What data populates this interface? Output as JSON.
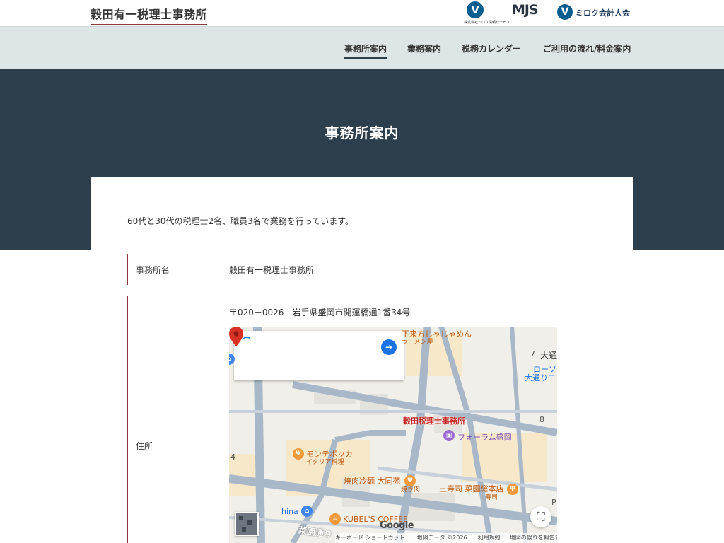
{
  "header": {
    "site_title": "穀田有一税理士事務所",
    "logos": {
      "mirokujoho_caption": "株式会社ミロク情報サービス",
      "mjs": "MJS",
      "miroku_kaikeijin": "ミロク会計人会"
    }
  },
  "nav": {
    "items": [
      {
        "label": "事務所案内",
        "active": true
      },
      {
        "label": "業務案内"
      },
      {
        "label": "税務カレンダー"
      },
      {
        "label": "ご利用の流れ/料金案内"
      }
    ]
  },
  "hero": {
    "title": "事務所案内"
  },
  "content": {
    "intro": "60代と30代の税理士2名、職員3名で業務を行っています。",
    "rows": [
      {
        "label": "事務所名",
        "value": "穀田有一税理士事務所"
      },
      {
        "label": "住所",
        "value": "〒020－0026　岩手県盛岡市開運橋通1番34号"
      }
    ]
  },
  "map": {
    "pin_label": "穀田税理士事務所",
    "places": {
      "ramen": "下来方じゃじゃめん",
      "ramen_sub": "ラーメン屋",
      "forum": "フォーラム盛岡",
      "montepokka": "モンテポッカ",
      "montepokka_sub": "イタリア料理",
      "reimen": "焼肉冷麺 大同苑",
      "reimen_sub": "焼き肉",
      "sanjushi": "三寿司 菜園総本店",
      "sanjushi_sub": "寿司",
      "kubels": "KUBEL'S COFFEE",
      "hina": "hina",
      "lawson": "ローソ",
      "lawson_sub": "大通り二",
      "odori": "大通",
      "saien_street": "菜園通り"
    },
    "numbers": {
      "n7": "7",
      "n8": "8",
      "n4": "4",
      "p": "P"
    },
    "google": "Google",
    "attribution": {
      "shortcuts": "キーボード ショートカット",
      "data": "地図データ ©2026",
      "terms": "利用規約",
      "report": "地図の誤りを報告する"
    }
  },
  "colors": {
    "nav_bg": "#dde6e6",
    "hero_bg": "#2d3e4d",
    "accent": "#8a3a3a",
    "map_pin": "#d93025"
  }
}
